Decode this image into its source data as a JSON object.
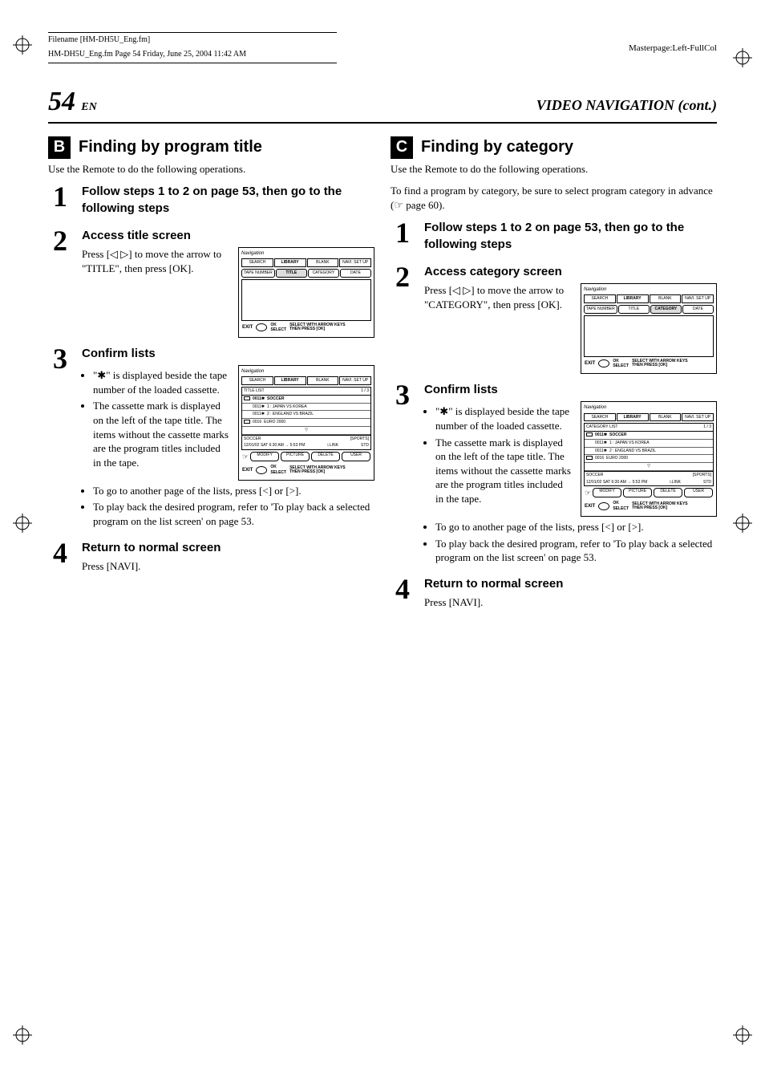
{
  "meta": {
    "filename_label": "Filename [HM-DH5U_Eng.fm]",
    "runhead": "HM-DH5U_Eng.fm  Page 54  Friday, June 25, 2004  11:42 AM",
    "masterpage": "Masterpage:Left-FullCol"
  },
  "page": {
    "number": "54",
    "lang": "EN",
    "section": "VIDEO NAVIGATION (cont.)"
  },
  "section_b": {
    "letter": "B",
    "heading": "Finding by program title",
    "intro": "Use the Remote to do the following operations.",
    "step1": {
      "num": "1",
      "title": "Follow steps 1 to 2 on page 53, then go to the following steps"
    },
    "step2": {
      "num": "2",
      "title": "Access title screen",
      "text": "Press [◁ ▷] to move the arrow to \"TITLE\", then press [OK].",
      "diagram": {
        "nav": "Navigation",
        "tabs": [
          "SEARCH",
          "LIBRARY",
          "BLANK",
          "NAVI. SET UP"
        ],
        "active_tab": 1,
        "subtabs": [
          "TAPE NUMBER",
          "TITLE",
          "CATEGORY",
          "DATE"
        ],
        "active_subtab": 1,
        "exit": "EXIT",
        "ok": "OK",
        "select": "SELECT",
        "hint1": "SELECT WITH ARROW KEYS",
        "hint2": "THEN PRESS [OK]"
      }
    },
    "step3": {
      "num": "3",
      "title": "Confirm lists",
      "bullets_a": [
        "\"✱\" is displayed beside the tape number of the loaded cassette.",
        "The cassette mark is displayed on the left of the tape title. The items without the cassette marks are the program titles included in the tape."
      ],
      "bullets_b": [
        "To go to another page of the lists, press [<] or [>].",
        "To play back the desired program, refer to 'To play back a selected program on the list screen' on page 53."
      ],
      "diagram": {
        "nav": "Navigation",
        "tabs": [
          "SEARCH",
          "LIBRARY",
          "BLANK",
          "NAVI. SET UP"
        ],
        "active_tab": 1,
        "list_head": "TITLE LIST",
        "page_ind": "1 / 3",
        "rows": [
          {
            "mark": true,
            "code": "0011✱",
            "title": "SOCCER",
            "bold": true
          },
          {
            "mark": false,
            "code": "0011✱",
            "title": "1 : JAPAN VS KOREA"
          },
          {
            "mark": false,
            "code": "0011✱",
            "title": "2 : ENGLAND VS BRAZIL"
          },
          {
            "mark": true,
            "code": "0016",
            "title": "EURO 2000"
          }
        ],
        "info": {
          "title": "SOCCER",
          "date": "12/01/02 SAT  6:30 AM → 5:53 PM",
          "src": "i.LINK",
          "cat": "[SPORTS]",
          "std": "STD"
        },
        "buttons": [
          "MODIFY",
          "PICTURE",
          "DELETE",
          "USER"
        ],
        "exit": "EXIT",
        "ok": "OK",
        "select": "SELECT",
        "hint1": "SELECT WITH ARROW KEYS",
        "hint2": "THEN PRESS [OK]"
      }
    },
    "step4": {
      "num": "4",
      "title": "Return to normal screen",
      "text": "Press [NAVI]."
    }
  },
  "section_c": {
    "letter": "C",
    "heading": "Finding by category",
    "intro1": "Use the Remote to do the following operations.",
    "intro2_a": "To find a program by category, be sure to select program category in advance (",
    "intro2_b": " page 60).",
    "step1": {
      "num": "1",
      "title": "Follow steps 1 to 2 on page 53, then go to the following steps"
    },
    "step2": {
      "num": "2",
      "title": "Access category screen",
      "text": "Press [◁ ▷] to move the arrow to \"CATEGORY\", then press [OK].",
      "diagram": {
        "nav": "Navigation",
        "tabs": [
          "SEARCH",
          "LIBRARY",
          "BLANK",
          "NAVI. SET UP"
        ],
        "active_tab": 1,
        "subtabs": [
          "TAPE NUMBER",
          "TITLE",
          "CATEGORY",
          "DATE"
        ],
        "active_subtab": 2,
        "exit": "EXIT",
        "ok": "OK",
        "select": "SELECT",
        "hint1": "SELECT WITH ARROW KEYS",
        "hint2": "THEN PRESS [OK]"
      }
    },
    "step3": {
      "num": "3",
      "title": "Confirm lists",
      "bullets_a": [
        "\"✱\" is displayed beside the tape number of the loaded cassette.",
        "The cassette mark is displayed on the left of the tape title. The items without the cassette marks are the program titles included in the tape."
      ],
      "bullets_b": [
        "To go to another page of the lists, press [<] or [>].",
        "To play back the desired program, refer to 'To play back a selected program on the list screen' on page 53."
      ],
      "diagram": {
        "nav": "Navigation",
        "tabs": [
          "SEARCH",
          "LIBRARY",
          "BLANK",
          "NAVI. SET UP"
        ],
        "active_tab": 1,
        "list_head": "CATEGORY LIST",
        "page_ind": "1 / 3",
        "rows": [
          {
            "mark": true,
            "code": "0011✱",
            "title": "SOCCER",
            "bold": true
          },
          {
            "mark": false,
            "code": "0011✱",
            "title": "1 : JAPAN VS KOREA"
          },
          {
            "mark": false,
            "code": "0011✱",
            "title": "2 : ENGLAND VS BRAZIL"
          },
          {
            "mark": true,
            "code": "0016",
            "title": "EURO 2000"
          }
        ],
        "info": {
          "title": "SOCCER",
          "date": "12/01/02 SAT  6:30 AM → 5:53 PM",
          "src": "i.LINK",
          "cat": "[SPORTS]",
          "std": "STD"
        },
        "buttons": [
          "MODIFY",
          "PICTURE",
          "DELETE",
          "USER"
        ],
        "exit": "EXIT",
        "ok": "OK",
        "select": "SELECT",
        "hint1": "SELECT WITH ARROW KEYS",
        "hint2": "THEN PRESS [OK]"
      }
    },
    "step4": {
      "num": "4",
      "title": "Return to normal screen",
      "text": "Press [NAVI]."
    }
  }
}
